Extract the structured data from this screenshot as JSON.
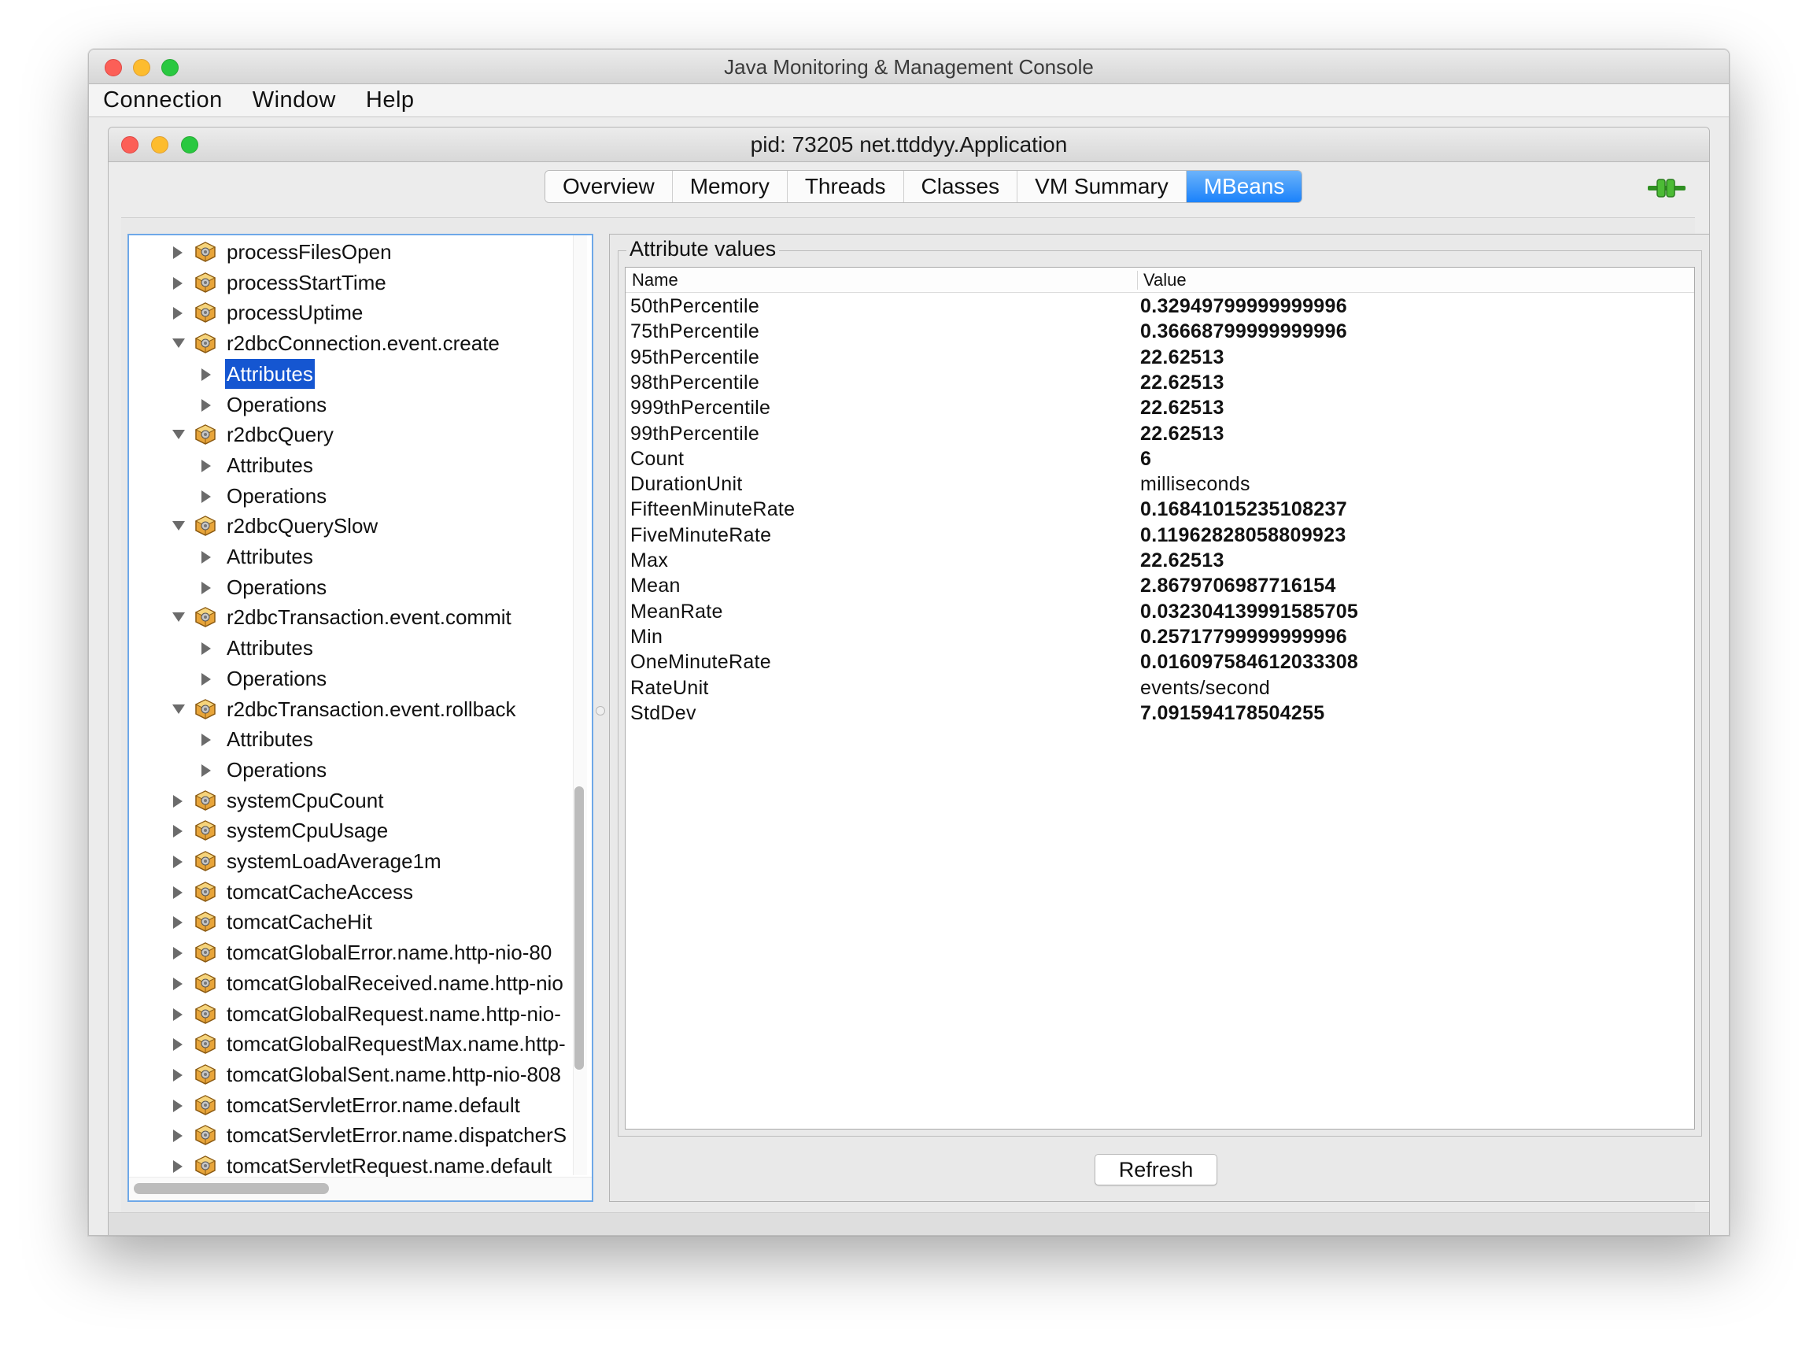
{
  "outer_window": {
    "title": "Java Monitoring & Management Console",
    "menu": [
      "Connection",
      "Window",
      "Help"
    ]
  },
  "inner_window": {
    "title": "pid: 73205 net.ttddyy.Application"
  },
  "tabs": [
    {
      "label": "Overview",
      "active": false
    },
    {
      "label": "Memory",
      "active": false
    },
    {
      "label": "Threads",
      "active": false
    },
    {
      "label": "Classes",
      "active": false
    },
    {
      "label": "VM Summary",
      "active": false
    },
    {
      "label": "MBeans",
      "active": true
    }
  ],
  "tree": {
    "items": [
      {
        "label": "processFilesOpen",
        "level": 0,
        "expanded": false,
        "icon": "bean-icon"
      },
      {
        "label": "processStartTime",
        "level": 0,
        "expanded": false,
        "icon": "bean-icon"
      },
      {
        "label": "processUptime",
        "level": 0,
        "expanded": false,
        "icon": "bean-icon"
      },
      {
        "label": "r2dbcConnection.event.create",
        "level": 0,
        "expanded": true,
        "icon": "bean-icon"
      },
      {
        "label": "Attributes",
        "level": 1,
        "expanded": false,
        "selected": true
      },
      {
        "label": "Operations",
        "level": 1,
        "expanded": false
      },
      {
        "label": "r2dbcQuery",
        "level": 0,
        "expanded": true,
        "icon": "bean-icon"
      },
      {
        "label": "Attributes",
        "level": 1,
        "expanded": false
      },
      {
        "label": "Operations",
        "level": 1,
        "expanded": false
      },
      {
        "label": "r2dbcQuerySlow",
        "level": 0,
        "expanded": true,
        "icon": "bean-icon"
      },
      {
        "label": "Attributes",
        "level": 1,
        "expanded": false
      },
      {
        "label": "Operations",
        "level": 1,
        "expanded": false
      },
      {
        "label": "r2dbcTransaction.event.commit",
        "level": 0,
        "expanded": true,
        "icon": "bean-icon"
      },
      {
        "label": "Attributes",
        "level": 1,
        "expanded": false
      },
      {
        "label": "Operations",
        "level": 1,
        "expanded": false
      },
      {
        "label": "r2dbcTransaction.event.rollback",
        "level": 0,
        "expanded": true,
        "icon": "bean-icon"
      },
      {
        "label": "Attributes",
        "level": 1,
        "expanded": false
      },
      {
        "label": "Operations",
        "level": 1,
        "expanded": false
      },
      {
        "label": "systemCpuCount",
        "level": 0,
        "expanded": false,
        "icon": "bean-icon"
      },
      {
        "label": "systemCpuUsage",
        "level": 0,
        "expanded": false,
        "icon": "bean-icon"
      },
      {
        "label": "systemLoadAverage1m",
        "level": 0,
        "expanded": false,
        "icon": "bean-icon"
      },
      {
        "label": "tomcatCacheAccess",
        "level": 0,
        "expanded": false,
        "icon": "bean-icon"
      },
      {
        "label": "tomcatCacheHit",
        "level": 0,
        "expanded": false,
        "icon": "bean-icon"
      },
      {
        "label": "tomcatGlobalError.name.http-nio-80",
        "level": 0,
        "expanded": false,
        "icon": "bean-icon"
      },
      {
        "label": "tomcatGlobalReceived.name.http-nio",
        "level": 0,
        "expanded": false,
        "icon": "bean-icon"
      },
      {
        "label": "tomcatGlobalRequest.name.http-nio-",
        "level": 0,
        "expanded": false,
        "icon": "bean-icon"
      },
      {
        "label": "tomcatGlobalRequestMax.name.http-",
        "level": 0,
        "expanded": false,
        "icon": "bean-icon"
      },
      {
        "label": "tomcatGlobalSent.name.http-nio-808",
        "level": 0,
        "expanded": false,
        "icon": "bean-icon"
      },
      {
        "label": "tomcatServletError.name.default",
        "level": 0,
        "expanded": false,
        "icon": "bean-icon"
      },
      {
        "label": "tomcatServletError.name.dispatcherS",
        "level": 0,
        "expanded": false,
        "icon": "bean-icon"
      },
      {
        "label": "tomcatServletRequest.name.default",
        "level": 0,
        "expanded": false,
        "icon": "bean-icon"
      }
    ]
  },
  "attributes": {
    "legend": "Attribute values",
    "columns": [
      "Name",
      "Value"
    ],
    "rows": [
      {
        "name": "50thPercentile",
        "value": "0.32949799999999996",
        "bold": true
      },
      {
        "name": "75thPercentile",
        "value": "0.36668799999999996",
        "bold": true
      },
      {
        "name": "95thPercentile",
        "value": "22.62513",
        "bold": true
      },
      {
        "name": "98thPercentile",
        "value": "22.62513",
        "bold": true
      },
      {
        "name": "999thPercentile",
        "value": "22.62513",
        "bold": true
      },
      {
        "name": "99thPercentile",
        "value": "22.62513",
        "bold": true
      },
      {
        "name": "Count",
        "value": "6",
        "bold": true
      },
      {
        "name": "DurationUnit",
        "value": "milliseconds",
        "bold": false
      },
      {
        "name": "FifteenMinuteRate",
        "value": "0.16841015235108237",
        "bold": true
      },
      {
        "name": "FiveMinuteRate",
        "value": "0.11962828058809923",
        "bold": true
      },
      {
        "name": "Max",
        "value": "22.62513",
        "bold": true
      },
      {
        "name": "Mean",
        "value": "2.8679706987716154",
        "bold": true
      },
      {
        "name": "MeanRate",
        "value": "0.032304139991585705",
        "bold": true
      },
      {
        "name": "Min",
        "value": "0.25717799999999996",
        "bold": true
      },
      {
        "name": "OneMinuteRate",
        "value": "0.016097584612033308",
        "bold": true
      },
      {
        "name": "RateUnit",
        "value": "events/second",
        "bold": false
      },
      {
        "name": "StdDev",
        "value": "7.091594178504255",
        "bold": true
      }
    ],
    "refresh_label": "Refresh"
  },
  "colors": {
    "selection": "#1556d1",
    "active_tab": "#1a82fb",
    "tree_focus_border": "#6ea8e8"
  }
}
